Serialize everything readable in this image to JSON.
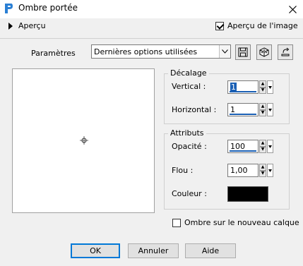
{
  "window": {
    "title": "Ombre portée"
  },
  "preview": {
    "toggle_label": "Aperçu",
    "show_preview_label": "Aperçu de l'image",
    "show_preview_checked": true
  },
  "presets": {
    "label": "Paramètres",
    "selected": "Dernières options utilisées"
  },
  "offset": {
    "title": "Décalage",
    "vertical_label": "Vertical :",
    "vertical_value": "1",
    "horizontal_label": "Horizontal :",
    "horizontal_value": "1"
  },
  "attributes": {
    "title": "Attributs",
    "opacity_label": "Opacité :",
    "opacity_value": "100",
    "blur_label": "Flou :",
    "blur_value": "1,00",
    "color_label": "Couleur :",
    "color_value": "#000000"
  },
  "shadow_new_layer": {
    "label": "Ombre sur le nouveau calque",
    "checked": false
  },
  "buttons": {
    "ok": "OK",
    "cancel": "Annuler",
    "help": "Aide"
  },
  "icons": [
    "app-icon",
    "close-icon",
    "expand-arrow-icon",
    "save-preset-icon",
    "random-cube-icon",
    "reset-icon",
    "crosshair-icon"
  ]
}
